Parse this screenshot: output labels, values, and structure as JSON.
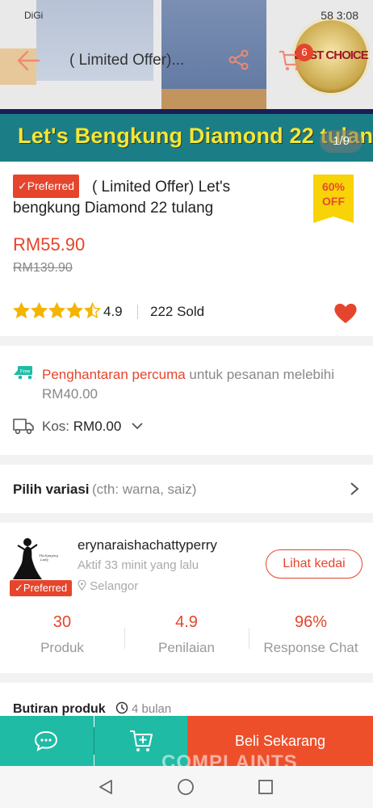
{
  "status_bar": {
    "left": "DiGi",
    "right": "58  3:08"
  },
  "header": {
    "title": "( Limited Offer)...",
    "cart_count": "6"
  },
  "hero": {
    "badge_text": "BEST CHOICE"
  },
  "banner": {
    "text": "Let's Bengkung  Diamond 22 tulang",
    "pager": "1/9"
  },
  "product": {
    "preferred_label": "Preferred",
    "title": "( Limited Offer)  Let's bengkung Diamond 22 tulang",
    "discount_line1": "60%",
    "discount_line2": "OFF",
    "price": "RM55.90",
    "original_price": "RM139.90",
    "rating": "4.9",
    "rating_stars": 4.5,
    "sold": "222 Sold"
  },
  "shipping": {
    "free_label": "Free",
    "free_text": "Penghantaran percuma",
    "free_rest": " untuk pesanan melebihi RM40.00",
    "kos_label": "Kos: ",
    "kos_value": "RM0.00"
  },
  "variation": {
    "label": "Pilih variasi",
    "hint": "(cth: warna, saiz)"
  },
  "shop": {
    "name": "erynaraishachattyperry",
    "active": "Aktif 33 minit yang lalu",
    "location": "Selangor",
    "preferred_label": "Preferred",
    "visit_button": "Lihat kedai",
    "stats": [
      {
        "value": "30",
        "label": "Produk"
      },
      {
        "value": "4.9",
        "label": "Penilaian"
      },
      {
        "value": "96%",
        "label": "Response Chat"
      }
    ]
  },
  "details": {
    "title": "Butiran produk",
    "time": "4 bulan"
  },
  "actions": {
    "buy_now": "Beli Sekarang",
    "watermark": "COMPLAINTS"
  },
  "colors": {
    "accent": "#e5452c",
    "teal": "#1fbba5",
    "star": "#f4b400"
  }
}
